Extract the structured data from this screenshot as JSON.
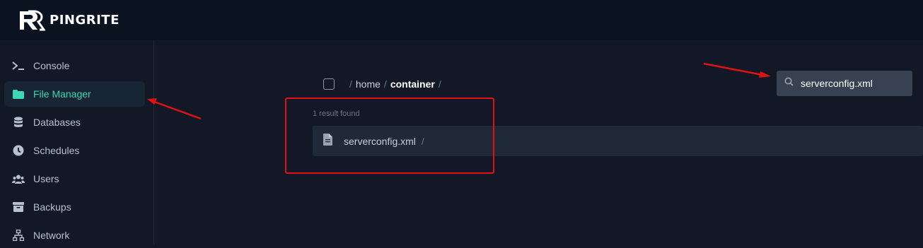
{
  "brand": {
    "name": "PINGRITE"
  },
  "sidebar": {
    "items": [
      {
        "label": "Console",
        "icon": "terminal-icon"
      },
      {
        "label": "File Manager",
        "icon": "folder-icon",
        "active": true
      },
      {
        "label": "Databases",
        "icon": "database-icon"
      },
      {
        "label": "Schedules",
        "icon": "clock-icon"
      },
      {
        "label": "Users",
        "icon": "users-icon"
      },
      {
        "label": "Backups",
        "icon": "archive-icon"
      },
      {
        "label": "Network",
        "icon": "network-icon"
      }
    ]
  },
  "breadcrumb": {
    "items": [
      "home",
      "container"
    ]
  },
  "search": {
    "value": "serverconfig.xml",
    "icon": "search-icon"
  },
  "results": {
    "count_label": "1 result found",
    "items": [
      {
        "name": "serverconfig.xml",
        "icon": "file-icon"
      }
    ]
  },
  "colors": {
    "accent": "#3fd6b2",
    "annotation": "#e31212",
    "topbar": "#0b1220",
    "background": "#121826"
  }
}
